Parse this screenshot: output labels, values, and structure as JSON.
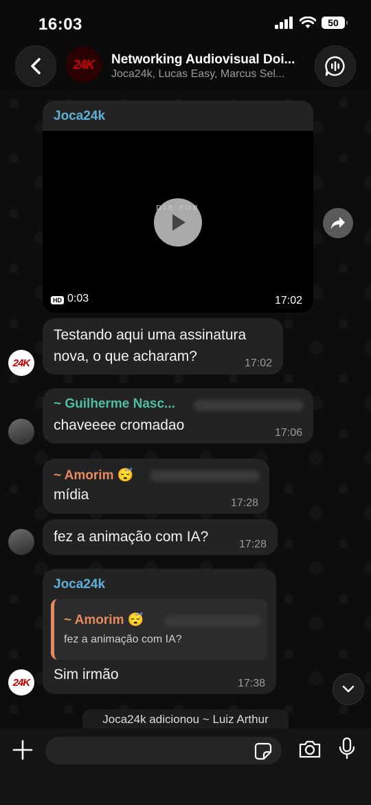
{
  "status": {
    "time": "16:03",
    "battery": "50"
  },
  "header": {
    "group_name": "Networking Audiovisual Doi...",
    "members": "Joca24k, Lucas Easy, Marcus Sel...",
    "avatar_text": "24K"
  },
  "messages": {
    "video": {
      "sender": "Joca24k",
      "overlay_text": "DIR      POR",
      "hd": "HD",
      "duration": "0:03",
      "time": "17:02"
    },
    "m1": {
      "text_line1": "Testando aqui uma assinatura",
      "text_line2": "nova, o que acharam?",
      "time": "17:02",
      "avatar": "24K"
    },
    "m2": {
      "sender": "~ Guilherme Nasc...",
      "text": "chaveeee cromadao",
      "time": "17:06"
    },
    "m3": {
      "sender": "~ Amorim 😴",
      "text": "mídia",
      "time": "17:28"
    },
    "m4": {
      "text": "fez a animação com IA?",
      "time": "17:28"
    },
    "m5": {
      "sender": "Joca24k",
      "quote_sender": "~ Amorim 😴",
      "quote_text": "fez a animação com IA?",
      "text": "Sim irmão",
      "time": "17:38",
      "avatar": "24K"
    }
  },
  "system_note": "Joca24k adicionou ~ Luiz Arthur",
  "colors": {
    "joca_name": "#5fb0d6",
    "guilherme_name": "#4fbfa0",
    "amorim_name": "#e78a5e",
    "bubble": "#232323"
  },
  "icons": [
    "chevron-left-icon",
    "voice-chat-icon",
    "play-icon",
    "forward-icon",
    "chevron-down-icon",
    "plus-icon",
    "sticker-icon",
    "camera-icon",
    "microphone-icon"
  ]
}
